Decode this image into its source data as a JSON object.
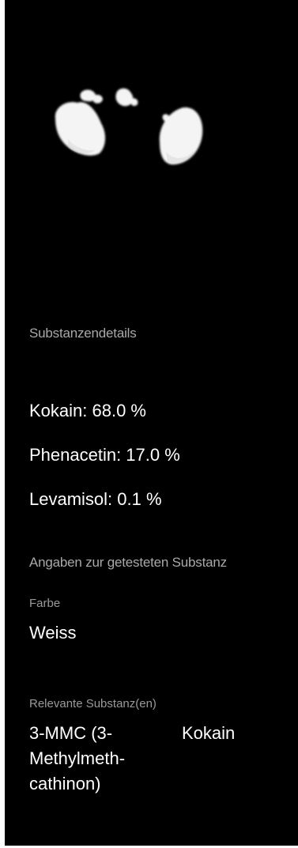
{
  "photo": {
    "subject": "white powder sample",
    "background_color": "#000000"
  },
  "substance_details": {
    "heading": "Substanzendetails",
    "components": [
      "Kokain: 68.0 %",
      "Phenacetin: 17.0 %",
      "Levamisol: 0.1 %"
    ]
  },
  "tested_substance": {
    "heading": "Angaben zur getesteten Substanz",
    "color_label": "Farbe",
    "color_value": "Weiss",
    "relevant_label": "Relevante Substanz(en)",
    "relevant_substances": [
      "3-MMC (3-Methylmeth-cathinon)",
      "Kokain"
    ]
  }
}
